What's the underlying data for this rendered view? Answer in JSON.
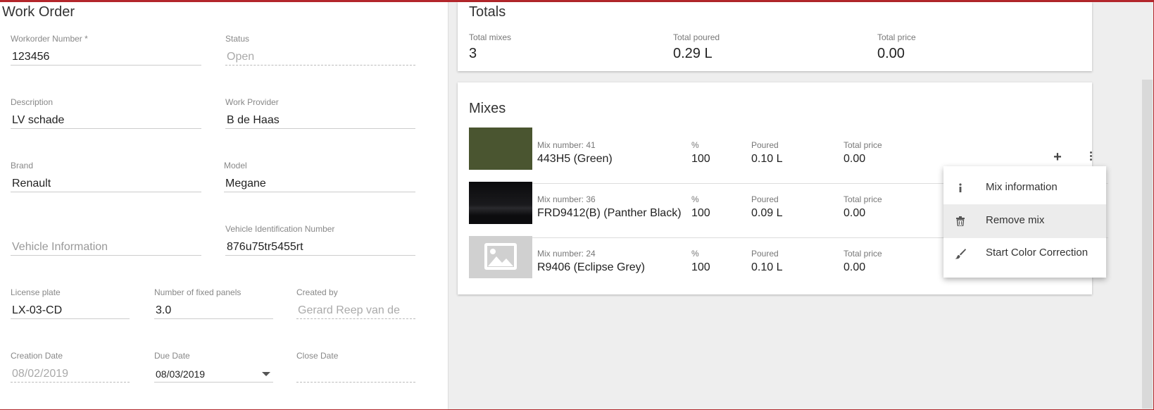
{
  "work_order": {
    "title": "Work Order",
    "fields": {
      "workorder_number": {
        "label": "Workorder Number *",
        "value": "123456"
      },
      "status": {
        "label": "Status",
        "value": "Open"
      },
      "description": {
        "label": "Description",
        "value": "LV schade"
      },
      "work_provider": {
        "label": "Work Provider",
        "value": "B de Haas"
      },
      "brand": {
        "label": "Brand",
        "value": "Renault"
      },
      "model": {
        "label": "Model",
        "value": "Megane"
      },
      "vehicle_information": {
        "placeholder": "Vehicle Information"
      },
      "vin": {
        "label": "Vehicle Identification Number",
        "value": "876u75tr5455rt"
      },
      "license_plate": {
        "label": "License plate",
        "value": "LX-03-CD"
      },
      "fixed_panels": {
        "label": "Number of fixed panels",
        "value": "3.0"
      },
      "created_by": {
        "label": "Created by",
        "value": "Gerard Reep van de"
      },
      "creation_date": {
        "label": "Creation Date",
        "value": "08/02/2019"
      },
      "due_date": {
        "label": "Due Date",
        "value": "08/03/2019"
      },
      "close_date": {
        "label": "Close Date",
        "value": ""
      }
    }
  },
  "totals": {
    "title": "Totals",
    "total_mixes": {
      "label": "Total mixes",
      "value": "3"
    },
    "total_poured": {
      "label": "Total poured",
      "value": "0.29 L"
    },
    "total_price": {
      "label": "Total price",
      "value": "0.00"
    }
  },
  "mixes": {
    "title": "Mixes",
    "labels": {
      "percent": "%",
      "poured": "Poured",
      "total_price": "Total price"
    },
    "items": [
      {
        "mix_number": "Mix number: 41",
        "name": "443H5 (Green)",
        "percent": "100",
        "poured": "0.10 L",
        "total_price": "0.00",
        "swatch": "#4a5530"
      },
      {
        "mix_number": "Mix number: 36",
        "name": "FRD9412(B) (Panther Black)",
        "percent": "100",
        "poured": "0.09 L",
        "total_price": "0.00",
        "swatch": "#0d0d0f"
      },
      {
        "mix_number": "Mix number: 24",
        "name": "R9406 (Eclipse Grey)",
        "percent": "100",
        "poured": "0.10 L",
        "total_price": "0.00",
        "swatch": "#d0d0d0",
        "swatch_icon": "image-placeholder-icon"
      }
    ]
  },
  "menu": {
    "items": [
      {
        "label": "Mix information",
        "icon": "info-icon"
      },
      {
        "label": "Remove mix",
        "icon": "trash-icon"
      },
      {
        "label": "Start Color Correction",
        "icon": "brush-icon"
      }
    ]
  },
  "colors": {
    "accent": "#b3262b",
    "background": "#eeeeee"
  }
}
